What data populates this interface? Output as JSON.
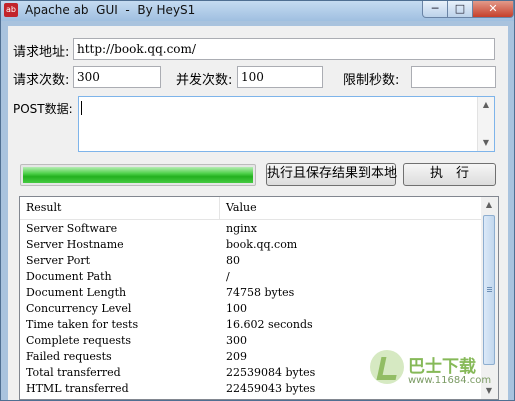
{
  "window": {
    "title": "Apache ab  GUI  -  By HeyS1",
    "minimize_glyph": "─",
    "maximize_glyph": "□",
    "close_glyph": "✕"
  },
  "form": {
    "url_label": "请求地址:",
    "url_value": "http://book.qq.com/",
    "requests_label": "请求次数:",
    "requests_value": "300",
    "concurrency_label": "并发次数:",
    "concurrency_value": "100",
    "time_limit_label": "限制秒数:",
    "time_limit_value": "",
    "post_label": "POST数据:",
    "post_value": ""
  },
  "progress": {
    "fraction": 1.0,
    "color": "#2bb527"
  },
  "buttons": {
    "run_and_save": "执行且保存结果到本地",
    "run": "执　行"
  },
  "results": {
    "columns": [
      "Result",
      "Value"
    ],
    "rows": [
      [
        "Server Software",
        "nginx"
      ],
      [
        "Server Hostname",
        "book.qq.com"
      ],
      [
        "Server Port",
        "80"
      ],
      [
        "Document Path",
        "/"
      ],
      [
        "Document Length",
        "74758 bytes"
      ],
      [
        "Concurrency Level",
        "100"
      ],
      [
        "Time taken for tests",
        "16.602 seconds"
      ],
      [
        "Complete requests",
        "300"
      ],
      [
        "Failed requests",
        "209"
      ],
      [
        "Total transferred",
        "22539084 bytes"
      ],
      [
        "HTML transferred",
        "22459043 bytes"
      ]
    ]
  },
  "icons": {
    "app": "apache-feather-icon",
    "scroll_up": "▲",
    "scroll_down": "▼"
  },
  "watermark": {
    "brand": "巴士下载",
    "url": "www.11684.com"
  }
}
